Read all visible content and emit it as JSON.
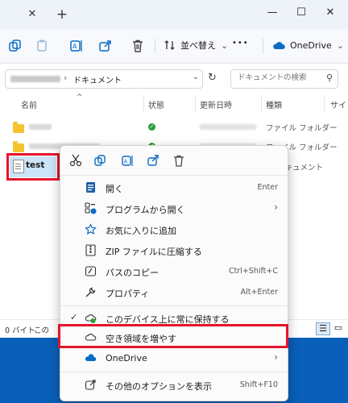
{
  "window": {
    "tab_close": "✕",
    "tab_add": "+",
    "minimize": "—",
    "maximize": "☐",
    "close": "✕"
  },
  "toolbar": {
    "sort_label": "並べ替え",
    "more": "•••",
    "onedrive_label": "OneDrive",
    "chevron": "⌄"
  },
  "address": {
    "path": "ドキュメント",
    "search_placeholder": "ドキュメントの検索"
  },
  "columns": {
    "name": "名前",
    "status": "状態",
    "modified": "更新日時",
    "type": "種類",
    "size": "サイ"
  },
  "rows": [
    {
      "type": "ファイル フォルダー"
    },
    {
      "type": "ファイル フォルダー"
    },
    {
      "name": "test",
      "type": "ドキュメント"
    }
  ],
  "statusbar": {
    "left_text": "0 バイト",
    "left_text2": "この"
  },
  "context_menu": {
    "items": [
      {
        "label": "開く",
        "shortcut": "Enter"
      },
      {
        "label": "プログラムから開く",
        "arrow": "›"
      },
      {
        "label": "お気に入りに追加"
      },
      {
        "label": "ZIP ファイルに圧縮する"
      },
      {
        "label": "パスのコピー",
        "shortcut": "Ctrl+Shift+C"
      },
      {
        "label": "プロパティ",
        "shortcut": "Alt+Enter"
      },
      {
        "label": "このデバイス上に常に保持する",
        "check": "✓"
      },
      {
        "label": "空き領域を増やす"
      },
      {
        "label": "OneDrive",
        "arrow": "›"
      },
      {
        "label": "その他のオプションを表示",
        "shortcut": "Shift+F10"
      }
    ]
  },
  "colors": {
    "accent": "#0a5fb8",
    "highlight_red": "#e3142a",
    "selection": "#cce4f7"
  }
}
